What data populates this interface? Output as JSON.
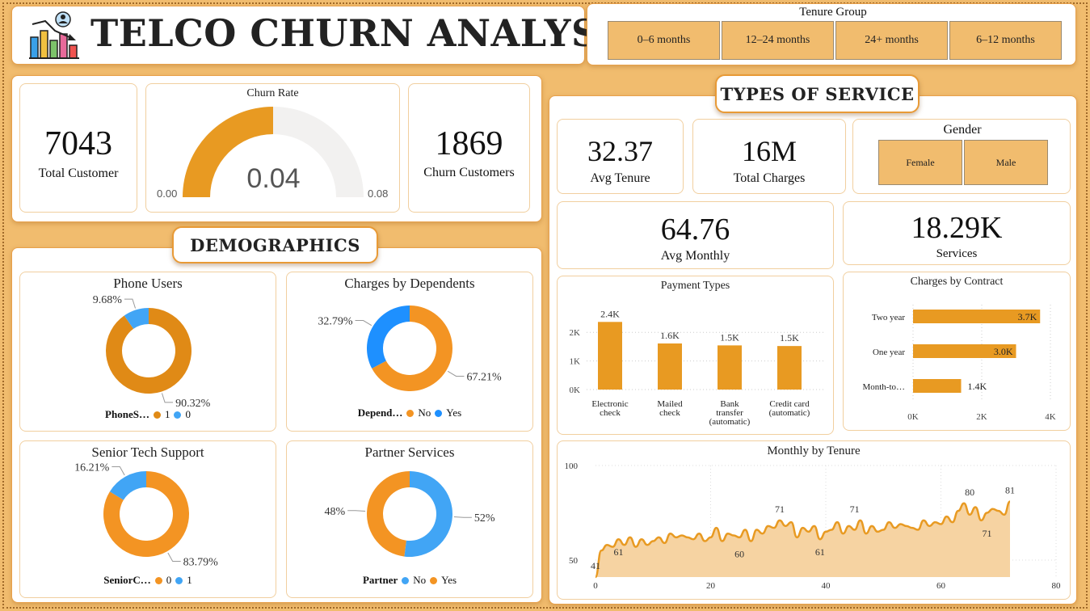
{
  "header": {
    "title": "TELCO CHURN ANALYSIS",
    "icon": "chart-analysis-icon"
  },
  "tenure_slicer": {
    "title": "Tenure Group",
    "options": [
      "0–6 months",
      "12–24 months",
      "24+ months",
      "6–12 months"
    ]
  },
  "kpis": {
    "total_customer": {
      "value": "7043",
      "label": "Total Customer"
    },
    "churn_rate": {
      "title": "Churn Rate",
      "value": "0.04",
      "min": "0.00",
      "max": "0.08",
      "fraction": 0.5
    },
    "churn_customers": {
      "value": "1869",
      "label": "Churn Customers"
    }
  },
  "sections": {
    "demographics": "DEMOGRAPHICS",
    "types_of_service": "TYPES OF SERVICE"
  },
  "service_kpis": {
    "avg_tenure": {
      "value": "32.37",
      "label": "Avg Tenure"
    },
    "total_charges": {
      "value": "16M",
      "label": "Total Charges"
    },
    "avg_monthly": {
      "value": "64.76",
      "label": "Avg Monthly"
    },
    "services": {
      "value": "18.29K",
      "label": "Services"
    }
  },
  "gender_slicer": {
    "title": "Gender",
    "options": [
      "Female",
      "Male"
    ]
  },
  "colors": {
    "orange": "#f39423",
    "dark_orange": "#e08a16",
    "blue": "#41a5f5",
    "bar": "#e89a22",
    "area_fill": "#f6d3a2",
    "gauge_bg": "#f2f1f0"
  },
  "chart_data": [
    {
      "type": "pie",
      "title": "Phone Users",
      "legend_title": "PhoneS…",
      "slices": [
        {
          "label": "1",
          "value": 90.32,
          "text": "90.32%",
          "color": "#e08a16"
        },
        {
          "label": "0",
          "value": 9.68,
          "text": "9.68%",
          "color": "#41a5f5"
        }
      ]
    },
    {
      "type": "pie",
      "title": "Charges by Dependents",
      "legend_title": "Depend…",
      "slices": [
        {
          "label": "No",
          "value": 67.21,
          "text": "67.21%",
          "color": "#f39423"
        },
        {
          "label": "Yes",
          "value": 32.79,
          "text": "32.79%",
          "color": "#1e90ff"
        }
      ]
    },
    {
      "type": "pie",
      "title": "Senior Tech Support",
      "legend_title": "SeniorC…",
      "slices": [
        {
          "label": "0",
          "value": 83.79,
          "text": "83.79%",
          "color": "#f39423"
        },
        {
          "label": "1",
          "value": 16.21,
          "text": "16.21%",
          "color": "#41a5f5"
        }
      ]
    },
    {
      "type": "pie",
      "title": "Partner Services",
      "legend_title": "Partner",
      "slices": [
        {
          "label": "No",
          "value": 52,
          "text": "52%",
          "color": "#41a5f5"
        },
        {
          "label": "Yes",
          "value": 48,
          "text": "48%",
          "color": "#f39423"
        }
      ]
    },
    {
      "type": "bar",
      "title": "Payment Types",
      "categories": [
        [
          "Electronic",
          "check"
        ],
        [
          "Mailed",
          "check"
        ],
        [
          "Bank",
          "transfer",
          "(automatic)"
        ],
        [
          "Credit card",
          "(automatic)"
        ]
      ],
      "values": [
        2365,
        1612,
        1544,
        1522
      ],
      "data_labels": [
        "2.4K",
        "1.6K",
        "1.5K",
        "1.5K"
      ],
      "y_ticks": [
        "0K",
        "1K",
        "2K"
      ],
      "ylim": [
        0,
        2600
      ]
    },
    {
      "type": "bar",
      "orientation": "horizontal",
      "title": "Charges by Contract",
      "categories": [
        "Two year",
        "One year",
        "Month-to…"
      ],
      "values": [
        3700,
        3000,
        1400
      ],
      "data_labels": [
        "3.7K",
        "3.0K",
        "1.4K"
      ],
      "x_ticks": [
        "0K",
        "2K",
        "4K"
      ],
      "xlim": [
        0,
        4000
      ]
    },
    {
      "type": "area",
      "title": "Monthly by Tenure",
      "xlim": [
        0,
        80
      ],
      "ylim": [
        41,
        100
      ],
      "x_ticks": [
        "0",
        "20",
        "40",
        "60",
        "80"
      ],
      "y_ticks": [
        "50",
        "100"
      ],
      "x": [
        0,
        1,
        2,
        3,
        4,
        5,
        6,
        7,
        8,
        9,
        10,
        11,
        12,
        13,
        14,
        15,
        16,
        17,
        18,
        19,
        20,
        21,
        22,
        23,
        24,
        25,
        26,
        27,
        28,
        29,
        30,
        31,
        32,
        33,
        34,
        35,
        36,
        37,
        38,
        39,
        40,
        41,
        42,
        43,
        44,
        45,
        46,
        47,
        48,
        49,
        50,
        51,
        52,
        53,
        54,
        55,
        56,
        57,
        58,
        59,
        60,
        61,
        62,
        63,
        64,
        65,
        66,
        67,
        68,
        69,
        70,
        71,
        72
      ],
      "y": [
        41,
        55,
        58,
        57,
        61,
        58,
        62,
        57,
        61,
        58,
        60,
        62,
        59,
        64,
        62,
        63,
        62,
        61,
        64,
        60,
        62,
        67,
        60,
        64,
        63,
        62,
        66,
        60,
        66,
        64,
        68,
        67,
        71,
        68,
        70,
        62,
        67,
        65,
        68,
        61,
        65,
        66,
        70,
        64,
        68,
        66,
        71,
        64,
        68,
        65,
        66,
        70,
        67,
        69,
        68,
        67,
        66,
        71,
        68,
        70,
        69,
        73,
        70,
        76,
        80,
        74,
        78,
        71,
        75,
        77,
        76,
        74,
        81
      ],
      "annotations": [
        {
          "x": 0,
          "y": 41,
          "text": "41"
        },
        {
          "x": 4,
          "y": 61,
          "text": "61"
        },
        {
          "x": 25,
          "y": 60,
          "text": "60"
        },
        {
          "x": 32,
          "y": 71,
          "text": "71"
        },
        {
          "x": 39,
          "y": 61,
          "text": "61"
        },
        {
          "x": 45,
          "y": 71,
          "text": "71"
        },
        {
          "x": 65,
          "y": 80,
          "text": "80"
        },
        {
          "x": 68,
          "y": 71,
          "text": "71"
        },
        {
          "x": 72,
          "y": 81,
          "text": "81"
        }
      ]
    }
  ]
}
